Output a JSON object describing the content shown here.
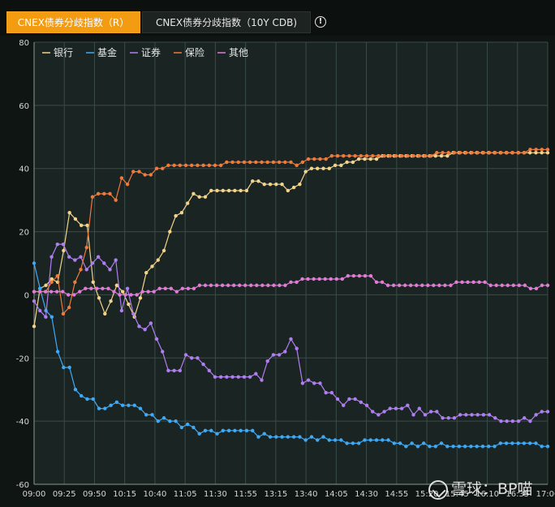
{
  "tabs": [
    {
      "label": "CNEX债券分歧指数（R）",
      "active": true
    },
    {
      "label": "CNEX债券分歧指数（10Y CDB)",
      "active": false
    }
  ],
  "info_icon": "info-icon",
  "watermark": {
    "text": "雪球：BP喵",
    "icon": "snowball-logo-icon"
  },
  "colors": {
    "background": "#0f1513",
    "plot_background": "#1a2523",
    "grid": "#3a4b47",
    "tab_active": "#f39c12"
  },
  "chart_data": {
    "type": "line",
    "title": "",
    "xlabel": "",
    "ylabel": "",
    "ylim": [
      -60,
      80
    ],
    "yticks": [
      -60,
      -40,
      -20,
      0,
      20,
      40,
      60,
      80
    ],
    "xtick_labels": [
      "09:00",
      "09:25",
      "09:50",
      "10:15",
      "10:40",
      "11:05",
      "11:30",
      "11:55",
      "13:15",
      "13:40",
      "14:05",
      "14:30",
      "14:55",
      "15:20",
      "15:45",
      "16:10",
      "16:35",
      "17:00"
    ],
    "grid": true,
    "legend_position": "top-left",
    "series": [
      {
        "name": "银行",
        "color": "#f3d38a",
        "values": [
          -10,
          2,
          3,
          5,
          4,
          14,
          26,
          24,
          22,
          22,
          4,
          -1,
          -6,
          -2,
          3,
          1,
          -3,
          -7,
          -1,
          7,
          9,
          11,
          14,
          20,
          25,
          26,
          29,
          32,
          31,
          31,
          33,
          33,
          33,
          33,
          33,
          33,
          33,
          36,
          36,
          35,
          35,
          35,
          35,
          33,
          34,
          35,
          39,
          40,
          40,
          40,
          40,
          41,
          41,
          42,
          42,
          43,
          43,
          43,
          43,
          44,
          44,
          44,
          44,
          44,
          44,
          44,
          44,
          44,
          44,
          44,
          44,
          45,
          45,
          45,
          45,
          45,
          45,
          45,
          45,
          45,
          45,
          45,
          45,
          45,
          45,
          45,
          45,
          45
        ]
      },
      {
        "name": "基金",
        "color": "#3fa9f5",
        "values": [
          10,
          2,
          -5,
          -7,
          -18,
          -23,
          -23,
          -30,
          -32,
          -33,
          -33,
          -36,
          -36,
          -35,
          -34,
          -35,
          -35,
          -35,
          -36,
          -38,
          -38,
          -40,
          -39,
          -40,
          -40,
          -42,
          -41,
          -42,
          -44,
          -43,
          -43,
          -44,
          -43,
          -43,
          -43,
          -43,
          -43,
          -43,
          -45,
          -44,
          -45,
          -45,
          -45,
          -45,
          -45,
          -45,
          -46,
          -45,
          -46,
          -45,
          -46,
          -46,
          -46,
          -47,
          -47,
          -47,
          -46,
          -46,
          -46,
          -46,
          -46,
          -47,
          -47,
          -48,
          -47,
          -48,
          -47,
          -48,
          -48,
          -47,
          -48,
          -48,
          -48,
          -48,
          -48,
          -48,
          -48,
          -48,
          -48,
          -47,
          -47,
          -47,
          -47,
          -47,
          -47,
          -47,
          -48,
          -48
        ]
      },
      {
        "name": "证券",
        "color": "#b07ef0",
        "values": [
          -2,
          -5,
          -7,
          12,
          16,
          16,
          12,
          11,
          12,
          8,
          10,
          12,
          10,
          8,
          11,
          -5,
          2,
          -6,
          -10,
          -11,
          -9,
          -14,
          -18,
          -24,
          -24,
          -24,
          -19,
          -20,
          -20,
          -22,
          -24,
          -26,
          -26,
          -26,
          -26,
          -26,
          -26,
          -26,
          -25,
          -27,
          -21,
          -19,
          -19,
          -18,
          -14,
          -17,
          -28,
          -27,
          -28,
          -28,
          -31,
          -31,
          -33,
          -35,
          -33,
          -33,
          -34,
          -35,
          -37,
          -38,
          -37,
          -36,
          -36,
          -36,
          -35,
          -38,
          -36,
          -38,
          -37,
          -37,
          -39,
          -39,
          -39,
          -38,
          -38,
          -38,
          -38,
          -38,
          -38,
          -39,
          -40,
          -40,
          -40,
          -40,
          -39,
          -40,
          -38,
          -37,
          -37
        ]
      },
      {
        "name": "保险",
        "color": "#f07a3c",
        "values": [
          1,
          1,
          1,
          4,
          6,
          -6,
          -4,
          4,
          8,
          15,
          31,
          32,
          32,
          32,
          30,
          37,
          35,
          39,
          39,
          38,
          38,
          40,
          40,
          41,
          41,
          41,
          41,
          41,
          41,
          41,
          41,
          41,
          41,
          42,
          42,
          42,
          42,
          42,
          42,
          42,
          42,
          42,
          42,
          42,
          42,
          41,
          42,
          43,
          43,
          43,
          43,
          44,
          44,
          44,
          44,
          44,
          44,
          44,
          44,
          44,
          44,
          44,
          44,
          44,
          44,
          44,
          44,
          44,
          44,
          45,
          45,
          45,
          45,
          45,
          45,
          45,
          45,
          45,
          45,
          45,
          45,
          45,
          45,
          45,
          45,
          46,
          46,
          46,
          46
        ]
      },
      {
        "name": "其他",
        "color": "#e07bd6",
        "values": [
          1,
          1,
          1,
          1,
          1,
          1,
          0,
          0,
          1,
          2,
          2,
          2,
          2,
          2,
          1,
          0,
          0,
          0,
          0,
          1,
          1,
          1,
          2,
          2,
          2,
          1,
          2,
          2,
          2,
          3,
          3,
          3,
          3,
          3,
          3,
          3,
          3,
          3,
          3,
          3,
          3,
          3,
          3,
          3,
          3,
          4,
          4,
          5,
          5,
          5,
          5,
          5,
          5,
          5,
          5,
          6,
          6,
          6,
          6,
          6,
          4,
          4,
          3,
          3,
          3,
          3,
          3,
          3,
          3,
          3,
          3,
          3,
          3,
          3,
          4,
          4,
          4,
          4,
          4,
          4,
          3,
          3,
          3,
          3,
          3,
          3,
          3,
          2,
          2,
          3,
          3
        ]
      }
    ]
  }
}
